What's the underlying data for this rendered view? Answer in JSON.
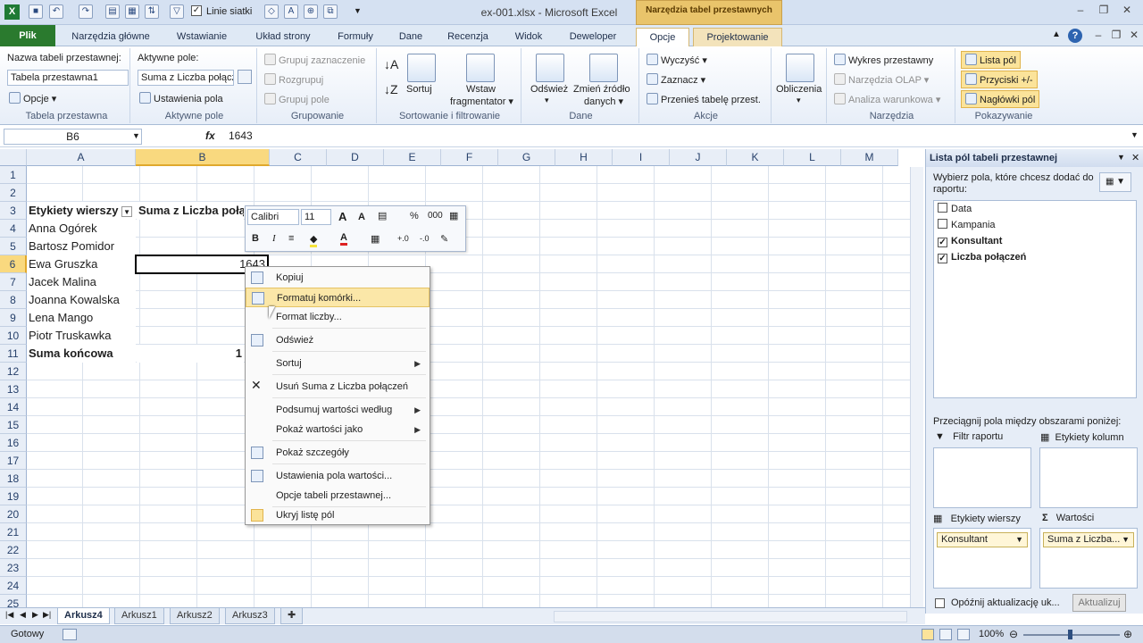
{
  "window": {
    "title": "ex-001.xlsx - Microsoft Excel",
    "context_tab": "Narzędzia tabel przestawnych",
    "qa_gridlines": "Linie siatki"
  },
  "tabs": {
    "file": "Plik",
    "home": "Narzędzia główne",
    "insert": "Wstawianie",
    "layout": "Układ strony",
    "formulas": "Formuły",
    "data": "Dane",
    "review": "Recenzja",
    "view": "Widok",
    "developer": "Deweloper",
    "options": "Opcje",
    "design": "Projektowanie"
  },
  "ribbon": {
    "pt": {
      "name_label": "Nazwa tabeli przestawnej:",
      "name_value": "Tabela przestawna1",
      "options": "Opcje",
      "group": "Tabela przestawna"
    },
    "af": {
      "label": "Aktywne pole:",
      "value": "Suma z Liczba połącz",
      "settings": "Ustawienia pola",
      "group": "Aktywne pole"
    },
    "grp": {
      "sel": "Grupuj zaznaczenie",
      "ungroup": "Rozgrupuj",
      "field": "Grupuj pole",
      "group": "Grupowanie"
    },
    "sort": {
      "sort": "Sortuj",
      "slicer1": "Wstaw",
      "slicer2": "fragmentator",
      "group": "Sortowanie i filtrowanie"
    },
    "data": {
      "refresh": "Odśwież",
      "source1": "Zmień źródło",
      "source2": "danych",
      "group": "Dane"
    },
    "act": {
      "clear": "Wyczyść",
      "select": "Zaznacz",
      "move": "Przenieś tabelę przest.",
      "group": "Akcje"
    },
    "calc": {
      "label": "Obliczenia"
    },
    "tools": {
      "chart": "Wykres przestawny",
      "olap": "Narzędzia OLAP",
      "whatif": "Analiza warunkowa",
      "group": "Narzędzia"
    },
    "show": {
      "fieldlist": "Lista pól",
      "buttons": "Przyciski +/-",
      "headers": "Nagłówki pól",
      "group": "Pokazywanie"
    }
  },
  "formula": {
    "namebox": "B6",
    "fx": "fx",
    "value": "1643"
  },
  "columns": [
    "A",
    "B",
    "C",
    "D",
    "E",
    "F",
    "G",
    "H",
    "I",
    "J",
    "K",
    "L",
    "M"
  ],
  "rows": [
    "1",
    "2",
    "3",
    "4",
    "5",
    "6",
    "7",
    "8",
    "9",
    "10",
    "11",
    "12",
    "13",
    "14",
    "15",
    "16",
    "17",
    "18",
    "19",
    "20",
    "21",
    "22",
    "23",
    "24",
    "25"
  ],
  "cells": {
    "row_labels": "Etykiety wierszy",
    "sum_header": "Suma z Liczba połączeń",
    "names": [
      "Anna Ogórek",
      "Bartosz Pomidor",
      "Ewa Gruszka",
      "Jacek Malina",
      "Joanna Kowalska",
      "Lena Mango",
      "Piotr Truskawka"
    ],
    "total": "Suma końcowa",
    "b6": "1643",
    "b11": "1"
  },
  "minitoolbar": {
    "font": "Calibri",
    "size": "11",
    "bold": "B",
    "italic": "I",
    "percent": "%",
    "thousands": "000"
  },
  "context_menu": [
    "Kopiuj",
    "Formatuj komórki...",
    "Format liczby...",
    "Odśwież",
    "Sortuj",
    "Usuń Suma z Liczba połączeń",
    "Podsumuj wartości według",
    "Pokaż wartości jako",
    "Pokaż szczegóły",
    "Ustawienia pola wartości...",
    "Opcje tabeli przestawnej...",
    "Ukryj listę pól"
  ],
  "field_pane": {
    "title": "Lista pól tabeli przestawnej",
    "choose": "Wybierz pola, które chcesz dodać do raportu:",
    "fields": [
      {
        "label": "Data",
        "checked": false
      },
      {
        "label": "Kampania",
        "checked": false
      },
      {
        "label": "Konsultant",
        "checked": true
      },
      {
        "label": "Liczba połączeń",
        "checked": true
      }
    ],
    "drag": "Przeciągnij pola między obszarami poniżej:",
    "filter": "Filtr raportu",
    "columns": "Etykiety kolumn",
    "rows": "Etykiety wierszy",
    "values": "Wartości",
    "rows_item": "Konsultant",
    "values_item": "Suma z Liczba...",
    "defer": "Opóźnij aktualizację uk...",
    "update": "Aktualizuj"
  },
  "sheets": [
    "Arkusz4",
    "Arkusz1",
    "Arkusz2",
    "Arkusz3"
  ],
  "status": {
    "ready": "Gotowy",
    "zoom": "100%"
  }
}
